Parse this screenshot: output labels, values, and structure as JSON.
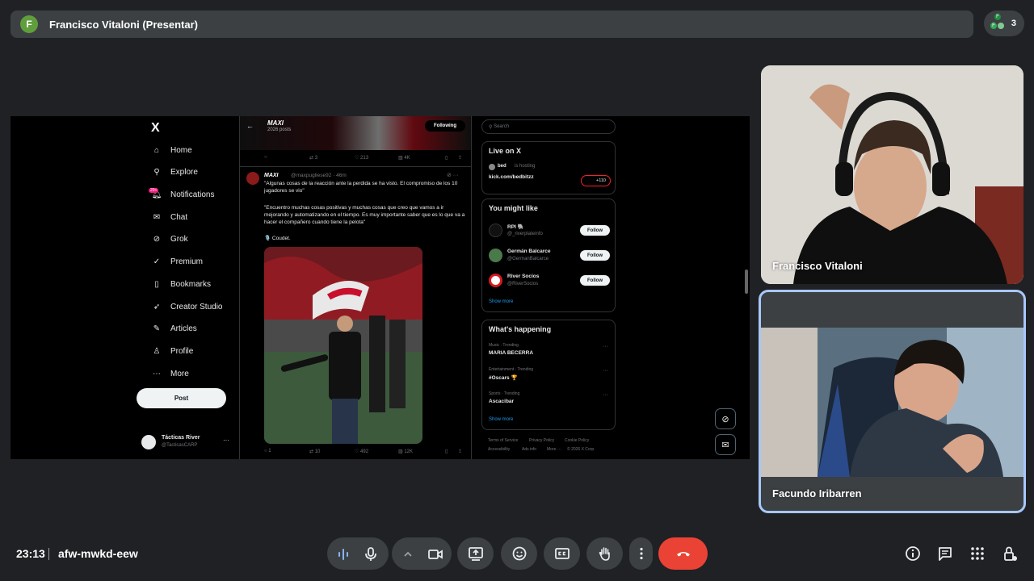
{
  "presenter": {
    "avatar_letter": "F",
    "name": "Francisco Vitaloni (Presentar)"
  },
  "participants": {
    "count": "3",
    "avatar_letters": [
      "F",
      "F"
    ]
  },
  "shared_screen": {
    "x_logo": "X",
    "nav": [
      {
        "label": "Home",
        "icon": "home-icon"
      },
      {
        "label": "Explore",
        "icon": "search-icon"
      },
      {
        "label": "Notifications",
        "icon": "bell-icon",
        "badge": "20+"
      },
      {
        "label": "Chat",
        "icon": "mail-icon"
      },
      {
        "label": "Grok",
        "icon": "grok-icon"
      },
      {
        "label": "Premium",
        "icon": "verified-icon"
      },
      {
        "label": "Bookmarks",
        "icon": "bookmark-icon"
      },
      {
        "label": "Creator Studio",
        "icon": "rocket-icon"
      },
      {
        "label": "Articles",
        "icon": "article-icon"
      },
      {
        "label": "Profile",
        "icon": "person-icon"
      },
      {
        "label": "More",
        "icon": "more-icon"
      }
    ],
    "post_button": "Post",
    "account": {
      "name": "Tácticas River",
      "handle": "@TacticasCARP"
    },
    "profile": {
      "name": "MAXI",
      "posts": "2026 posts",
      "following": "Following"
    },
    "prev_actions": {
      "replies": "",
      "reposts": "3",
      "likes": "213",
      "views": "4K"
    },
    "tweet": {
      "author": "MAXI",
      "meta": "@maxpugliese92 · 46m",
      "paragraphs": [
        "\"Algunas cosas de la reacción ante la perdida se ha visto. El compromiso de los 10 jugadores se vio\"",
        "\"Encuentro muchas cosas positivas y muchas cosas que creo que vamos a ir mejorando y automatizando en el tiempo. Es muy importante saber que es lo que va a hacer el compañero cuando tiene la pelota\"",
        "🎙️ Coudet."
      ],
      "actions": {
        "replies": "1",
        "reposts": "10",
        "likes": "492",
        "views": "12K"
      }
    },
    "search_placeholder": "Search",
    "live": {
      "title": "Live on X",
      "host": "bed",
      "host_status": "is hosting",
      "link": "kick.com/bedbitzz",
      "listeners": "+110"
    },
    "suggestions": {
      "title": "You might like",
      "items": [
        {
          "name": "RPI 🐘",
          "handle": "@_riverplateinfo",
          "button": "Follow",
          "color": "#111111"
        },
        {
          "name": "Germán Balcarce",
          "handle": "@GermanBalcarce",
          "button": "Follow",
          "color": "#4a7a4a"
        },
        {
          "name": "River Socios",
          "handle": "@RiverSocios",
          "button": "Follow",
          "color": "#d71920"
        }
      ],
      "show_more": "Show more"
    },
    "trends": {
      "title": "What's happening",
      "items": [
        {
          "context": "Music · Trending",
          "name": "MARIA BECERRA"
        },
        {
          "context": "Entertainment · Trending",
          "name": "#Oscars 🏆"
        },
        {
          "context": "Sports · Trending",
          "name": "Ascacibar"
        }
      ],
      "show_more": "Show more"
    },
    "footer": [
      "Terms of Service",
      "Privacy Policy",
      "Cookie Policy",
      "Accessibility",
      "Ads info",
      "More ···",
      "© 2026 X Corp."
    ]
  },
  "tiles": [
    {
      "name": "Francisco Vitaloni"
    },
    {
      "name": "Facundo Iribarren"
    }
  ],
  "bottom": {
    "time": "23:13",
    "meeting_code": "afw-mwkd-eew"
  },
  "colors": {
    "end_call": "#ea4335",
    "active_border": "#a8c7fa",
    "accent": "#1d9bf0"
  }
}
